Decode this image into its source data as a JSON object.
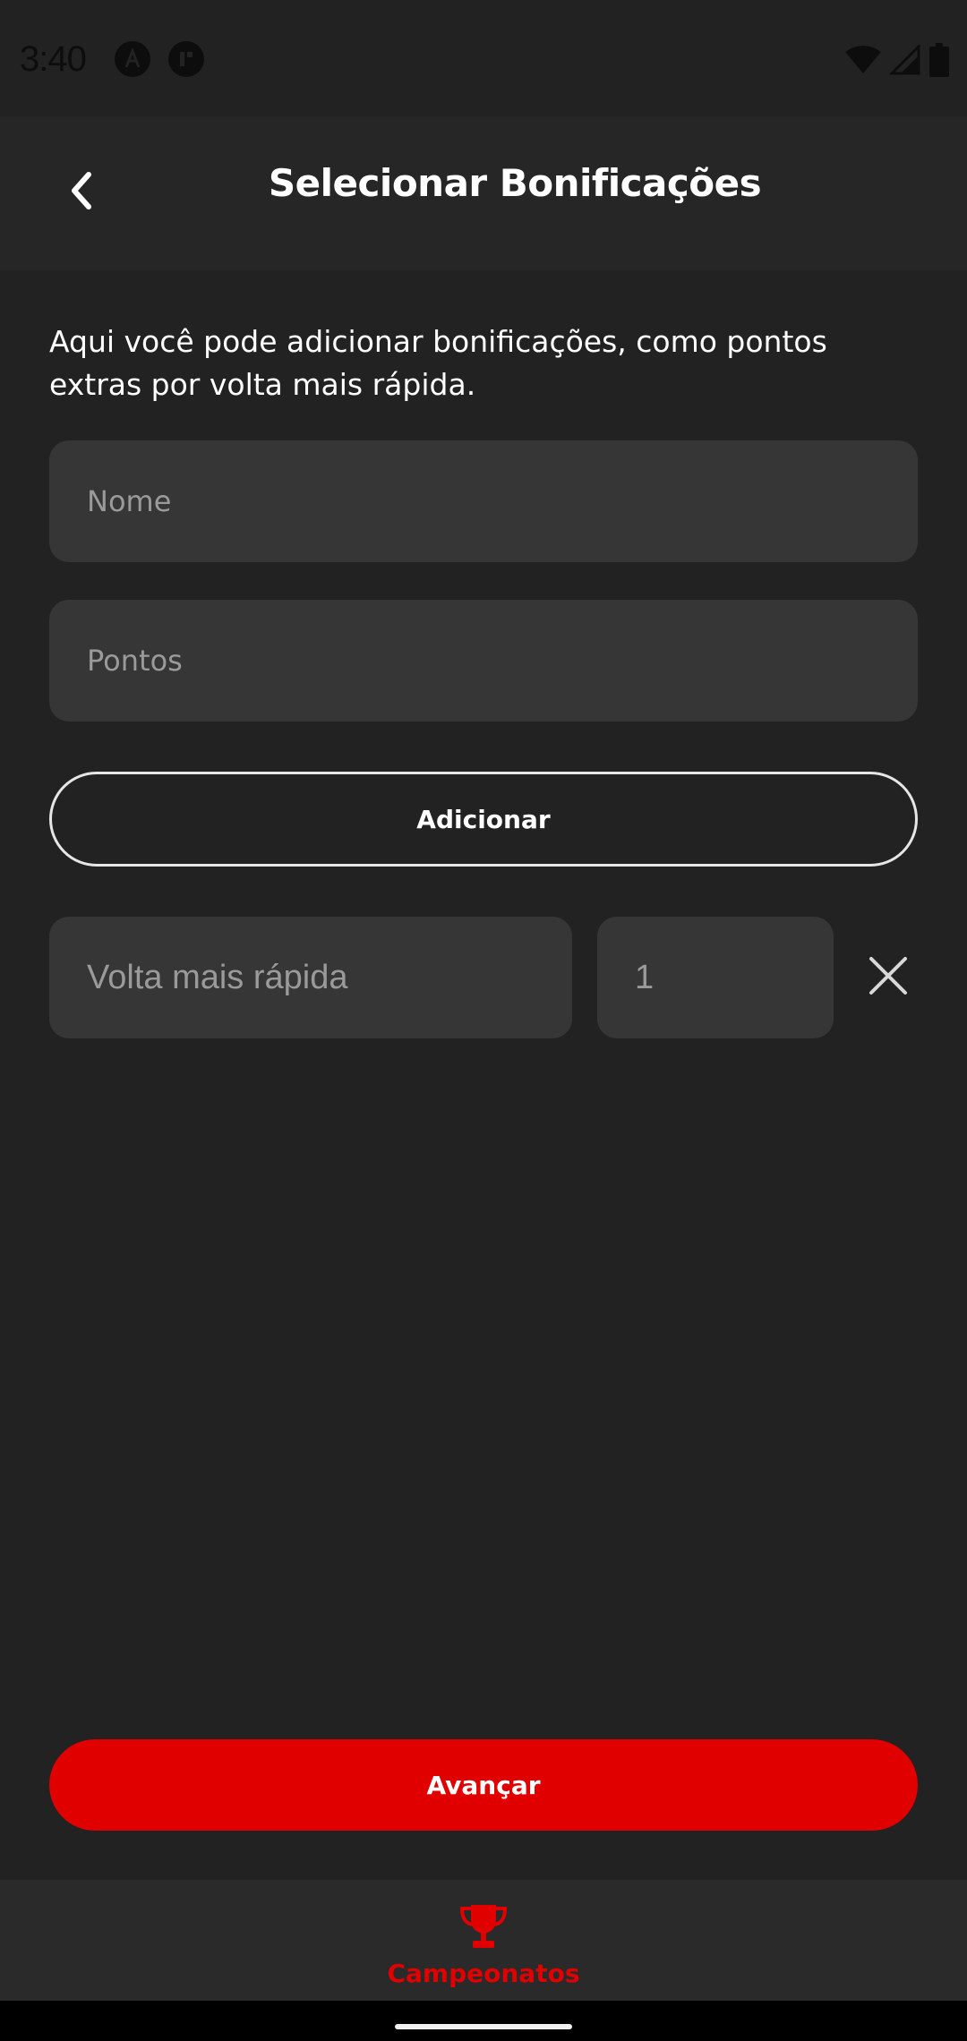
{
  "status_bar": {
    "time": "3:40",
    "icons": [
      "app-a-icon",
      "app-pause-icon",
      "wifi-icon",
      "signal-icon",
      "battery-icon"
    ]
  },
  "header": {
    "title": "Selecionar Bonificações",
    "back_icon": "chevron-left-icon"
  },
  "main": {
    "description": "Aqui você pode adicionar bonificações, como pontos extras por volta mais rápida.",
    "name_input": {
      "placeholder": "Nome",
      "value": ""
    },
    "points_input": {
      "placeholder": "Pontos",
      "value": ""
    },
    "add_button_label": "Adicionar",
    "bonuses": [
      {
        "name": "Volta mais rápida",
        "points": "1",
        "remove_icon": "close-icon"
      }
    ]
  },
  "footer": {
    "advance_button_label": "Avançar"
  },
  "bottom_nav": {
    "items": [
      {
        "label": "Campeonatos",
        "icon": "trophy-icon",
        "active": true
      }
    ]
  },
  "colors": {
    "background": "#222222",
    "header_background": "#262626",
    "input_background": "#363636",
    "accent": "#e00000",
    "placeholder_text": "#9a9a9a",
    "text": "#ffffff"
  }
}
